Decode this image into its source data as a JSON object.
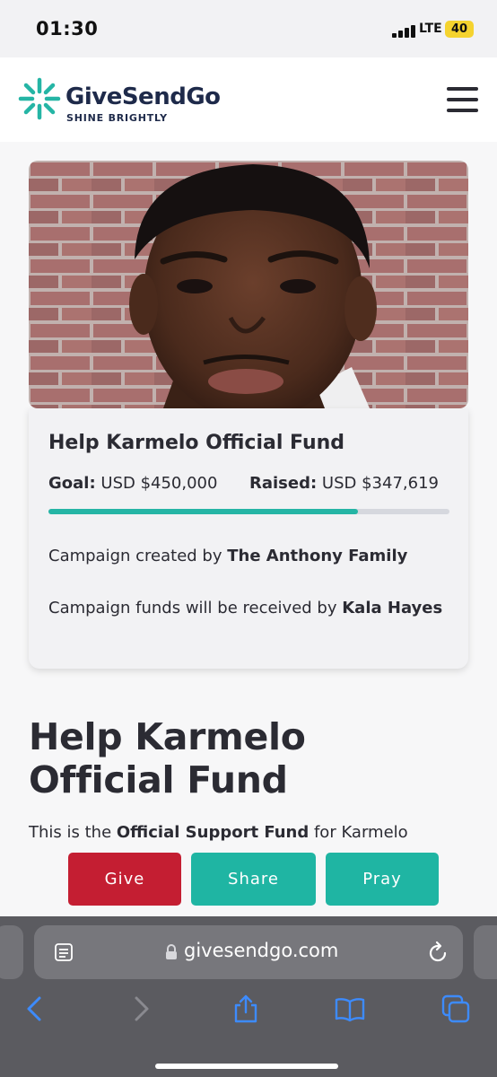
{
  "status_bar": {
    "time": "01:30",
    "network": "LTE",
    "battery": "40"
  },
  "header": {
    "logo_name": "GiveSendGo",
    "logo_tagline": "SHINE BRIGHTLY",
    "icons": [
      "logo-burst-icon",
      "hamburger-menu-icon"
    ],
    "brand_colors": {
      "navy": "#1e2a4a",
      "teal": "#25b5a5"
    }
  },
  "campaign_card": {
    "title": "Help Karmelo Official Fund",
    "goal_label": "Goal:",
    "goal_value": "USD $450,000",
    "raised_label": "Raised:",
    "raised_value": "USD $347,619",
    "progress_fraction": 0.7725,
    "created_by_prefix": "Campaign created by ",
    "created_by_name": "The Anthony Family",
    "received_by_prefix": "Campaign funds will be received by ",
    "received_by_name": "Kala Hayes"
  },
  "main": {
    "title": "Help Karmelo Official Fund",
    "intro_prefix": "This is the ",
    "intro_bold": "Official Support Fund",
    "intro_suffix": " for Karmelo"
  },
  "actions": {
    "give": "Give",
    "share": "Share",
    "pray": "Pray",
    "colors": {
      "give": "#c41e32",
      "share": "#1fb5a3",
      "pray": "#1fb5a3"
    }
  },
  "browser": {
    "url": "givesendgo.com",
    "icons": [
      "reader-mode-icon",
      "lock-icon",
      "reload-icon",
      "back-icon",
      "forward-icon",
      "share-icon",
      "bookmarks-icon",
      "tabs-icon"
    ]
  }
}
